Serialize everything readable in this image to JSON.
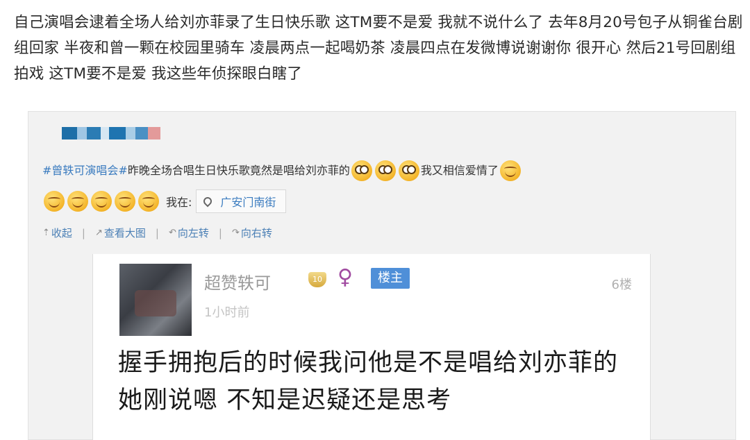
{
  "post": {
    "text": "自己演唱会逮着全场人给刘亦菲录了生日快乐歌 这TM要不是爱 我就不说什么了 去年8月20号包子从铜雀台剧组回家 半夜和曾一颗在校园里骑车 凌晨两点一起喝奶茶 凌晨四点在发微博说谢谢你 很开心 然后21号回剧组拍戏 这TM要不是爱 我这些年侦探眼白瞎了"
  },
  "repost": {
    "hashtag": "#曾轶可演唱会#",
    "text": "昨晚全场合唱生日快乐歌竟然是唱给刘亦菲的",
    "text_after": "我又相信爱情了",
    "location_prefix": "我在:",
    "location": "广安门南街"
  },
  "actions": {
    "collapse": "收起",
    "view_large": "查看大图",
    "rotate_left": "向左转",
    "rotate_right": "向右转"
  },
  "screenshot": {
    "username": "超赞轶可",
    "level": "10",
    "owner_badge": "楼主",
    "floor": "6楼",
    "time": "1小时前",
    "reply": "握手拥抱后的时候我问他是不是唱给刘亦菲的 她刚说嗯 不知是迟疑还是思考"
  },
  "colors": {
    "link": "#3a7bbf",
    "owner_badge": "#4f8fd8",
    "female": "#a04aa0"
  }
}
